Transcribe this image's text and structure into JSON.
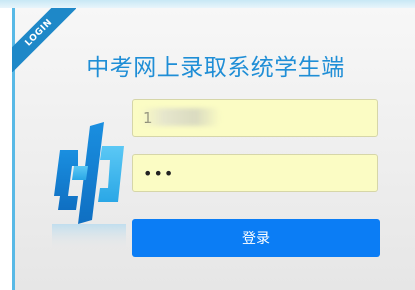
{
  "ribbon": {
    "label": "LOGIN"
  },
  "header": {
    "title": "中考网上录取系统学生端"
  },
  "form": {
    "username_value": "1",
    "password_value": "•••",
    "submit_label": "登录"
  },
  "colors": {
    "title": "#1f8ed6",
    "ribbon": "#1e88c8",
    "input_background": "#fbfcc4",
    "button": "#0b7df5",
    "accent_border": "#58b9e6"
  },
  "icons": {
    "logo": "stylized-logo-icon"
  }
}
